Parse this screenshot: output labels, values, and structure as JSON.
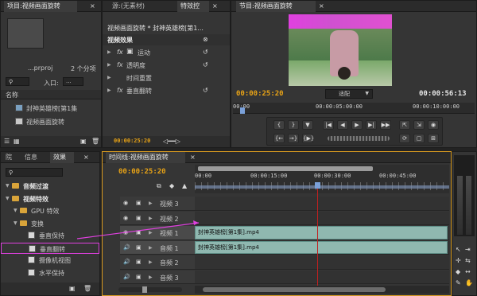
{
  "project_panel": {
    "tab_label": "项目:视频画面旋转",
    "filename": "...prproj",
    "item_count": "2 个分项",
    "entry_label": "入口:",
    "entry_value": "...",
    "name_header": "名称",
    "items": [
      {
        "label": "封神英雄榜[第1集"
      },
      {
        "label": "视频画面旋转"
      }
    ]
  },
  "effects_controls_panel": {
    "tab_source": "源:(无素材)",
    "tab_effects_controls": "特效控",
    "sequence_label": "视频画面旋转 * 封神英雄榜[第1...",
    "section_title": "视频效果",
    "effects": [
      {
        "fx": "fx",
        "label": "运动"
      },
      {
        "fx": "fx",
        "label": "透明度"
      },
      {
        "fx": "",
        "label": "时间重置"
      },
      {
        "fx": "fx",
        "label": "垂直翻转"
      }
    ],
    "timecode": "00:00:25:20"
  },
  "program_monitor": {
    "tab_label": "节目:视频画面旋转",
    "current_time": "00:00:25:20",
    "fit_label": "适配",
    "duration": "00:00:56:13",
    "ruler_labels": [
      "00:00",
      "00:00:05:00:00",
      "00:00:10:00:00"
    ],
    "playhead_fraction": 0.03
  },
  "effects_panel": {
    "tabs": [
      "院",
      "信息",
      "效果"
    ],
    "tree": [
      {
        "level": 1,
        "label": "音频过渡",
        "bold": true
      },
      {
        "level": 1,
        "label": "视频特效",
        "bold": true
      },
      {
        "level": 2,
        "label": "GPU 特效"
      },
      {
        "level": 2,
        "label": "变换"
      },
      {
        "level": 3,
        "label": "垂直保持"
      },
      {
        "level": 3,
        "label": "垂直翻转",
        "selected": true
      },
      {
        "level": 3,
        "label": "摄像机视图"
      },
      {
        "level": 3,
        "label": "水平保持"
      }
    ]
  },
  "timeline": {
    "tab_label": "时间线:视频画面旋转",
    "timecode": "00:00:25:20",
    "ruler_labels": [
      "00:00",
      "00:00:15:00",
      "00:00:30:00",
      "00:00:45:00"
    ],
    "playhead_fraction": 0.48,
    "tracks": [
      {
        "label": "视频 3",
        "kind": "video"
      },
      {
        "label": "视频 2",
        "kind": "video"
      },
      {
        "label": "视频 1",
        "kind": "video"
      },
      {
        "label": "音频 1",
        "kind": "audio"
      },
      {
        "label": "音频 2",
        "kind": "audio"
      },
      {
        "label": "音频 3",
        "kind": "audio"
      }
    ],
    "video_clip_label": "封神英雄榜[第1集].mp4",
    "audio_clip_label": "封神英雄榜[第1集].mp4"
  },
  "colors": {
    "timecode": "#e8a316",
    "clip": "#8fb8b0",
    "accent_magenta": "#e040e0",
    "playhead": "#c02020"
  }
}
